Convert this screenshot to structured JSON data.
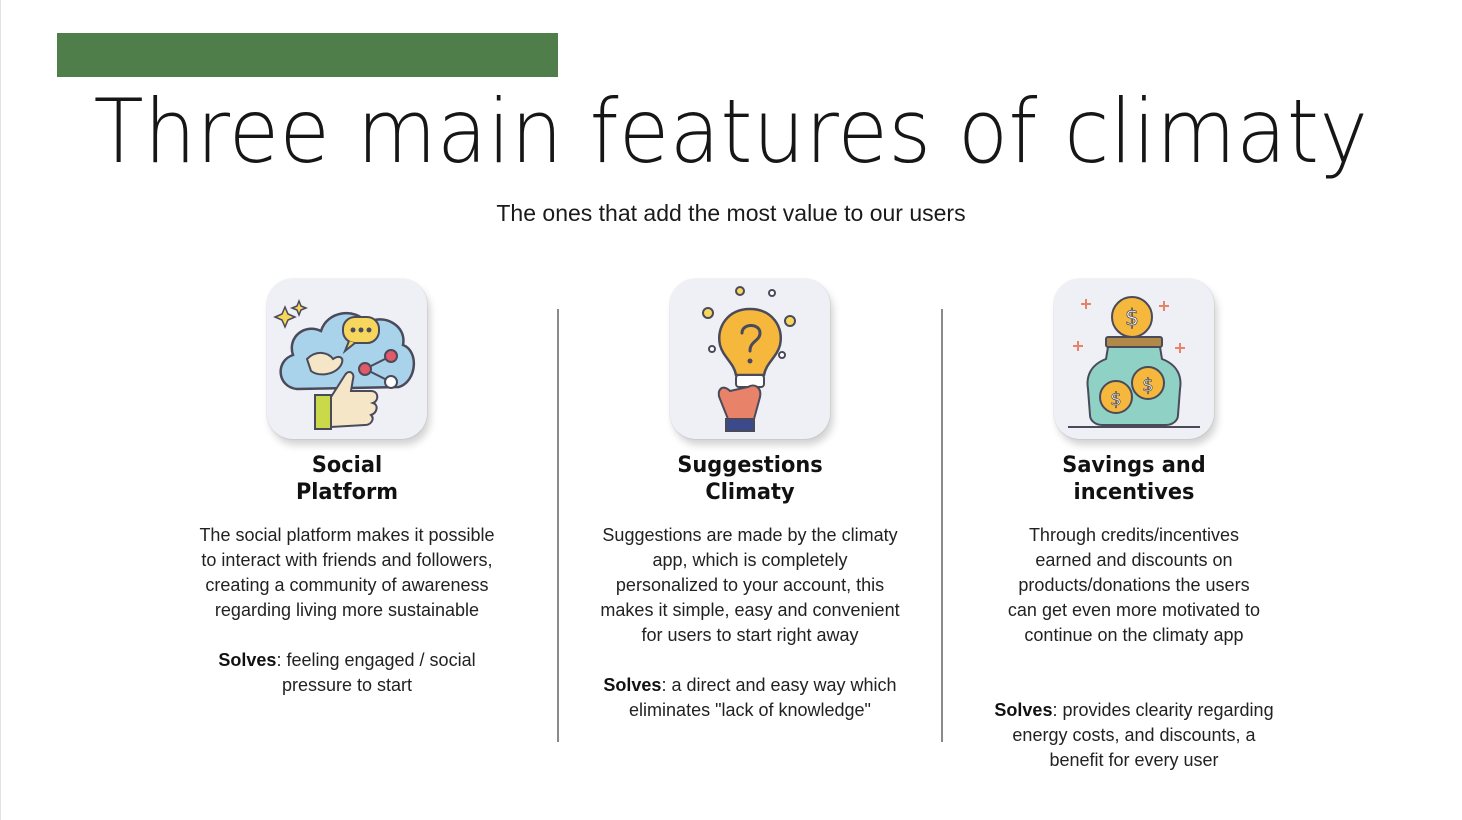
{
  "slide": {
    "title": "Three main features of climaty",
    "subtitle": "The ones that add the most value to our users",
    "accent_color": "#4f7e4b"
  },
  "features": [
    {
      "title_line1": "Social",
      "title_line2": "Platform",
      "description": "The social platform makes it possible to interact with friends and followers, creating a community of awareness regarding living more sustainable",
      "solves_label": "Solves",
      "solves_text": ": feeling engaged / social pressure to start",
      "icon": "social-cloud-icon"
    },
    {
      "title_line1": "Suggestions",
      "title_line2": "Climaty",
      "description": "Suggestions are made by the climaty app, which is completely personalized to your account, this makes it simple, easy and convenient for users to start right away",
      "solves_label": "Solves",
      "solves_text": ": a direct and easy way which eliminates \"lack of knowledge\"",
      "icon": "lightbulb-question-icon"
    },
    {
      "title_line1": "Savings and",
      "title_line2": "incentives",
      "description": "Through credits/incentives earned and discounts on products/donations the users can get even more motivated to continue on the climaty app",
      "solves_label": "Solves",
      "solves_text": ": provides clearity regarding energy costs, and discounts, a benefit for every user",
      "icon": "coin-jar-icon"
    }
  ]
}
